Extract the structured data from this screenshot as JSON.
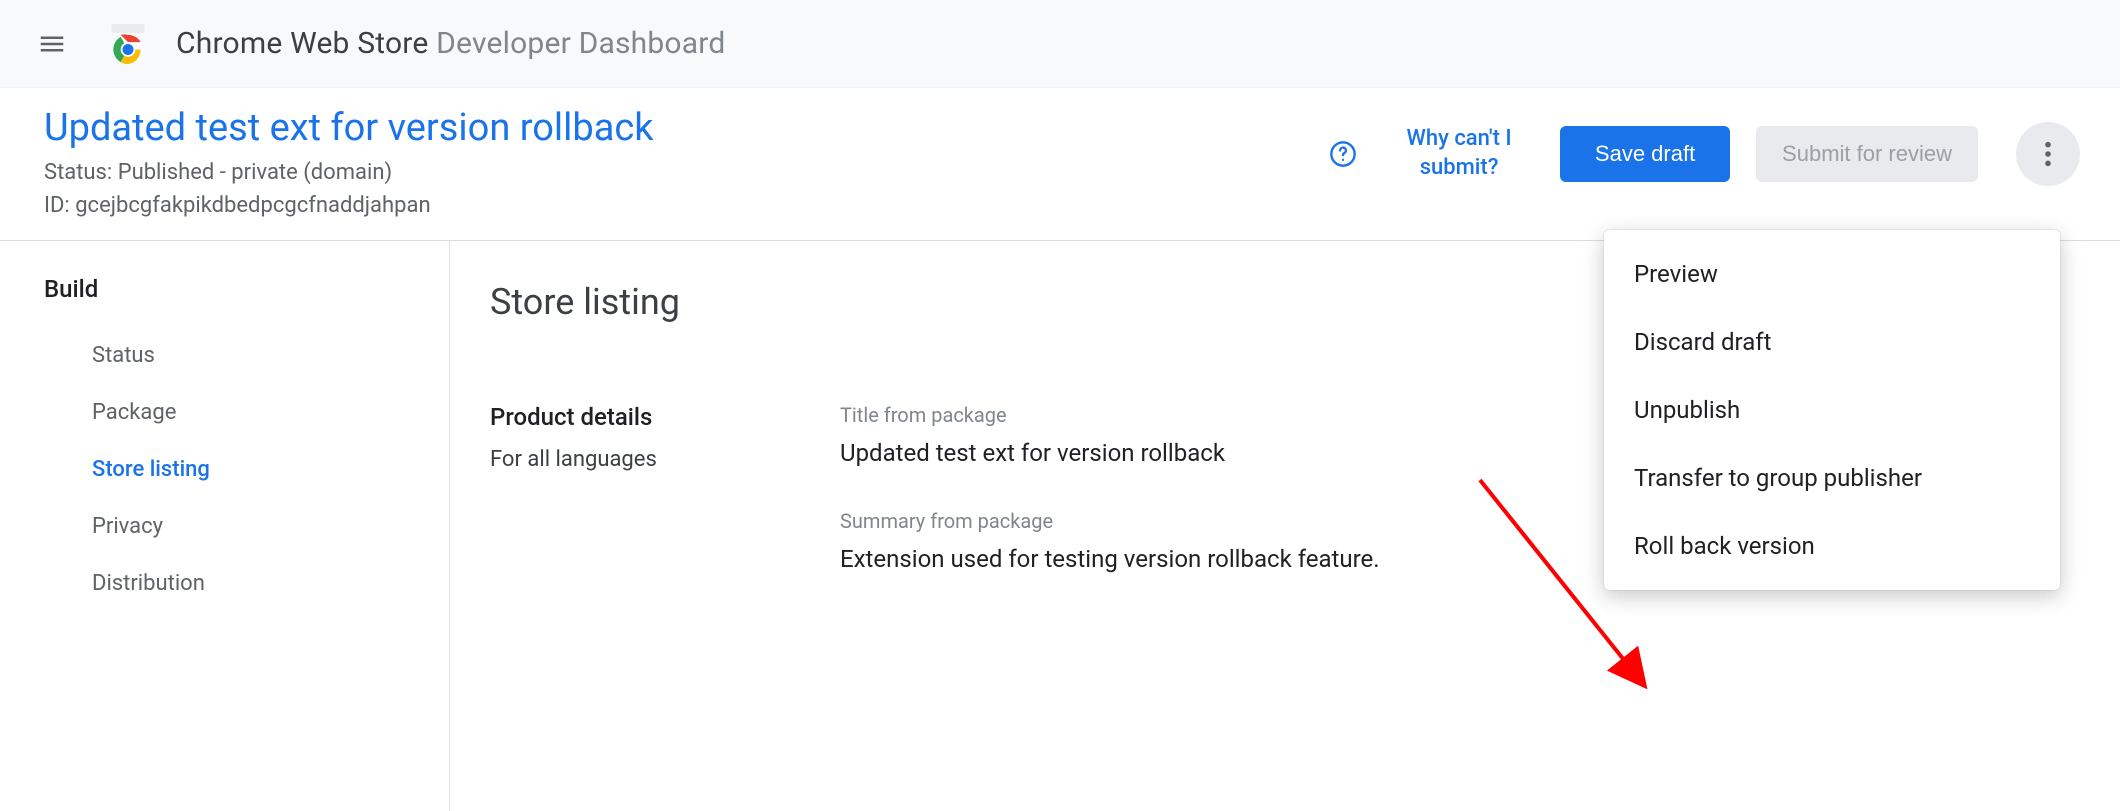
{
  "brand": {
    "name": "Chrome Web Store",
    "section": "Developer Dashboard"
  },
  "extension": {
    "title": "Updated test ext for version rollback",
    "status_label": "Status: Published - private (domain)",
    "id_label": "ID: gcejbcgfakpikdbedpcgcfnaddjahpan"
  },
  "header_actions": {
    "why_cant_submit": "Why can't I submit?",
    "save_draft": "Save draft",
    "submit_for_review": "Submit for review"
  },
  "sidebar": {
    "heading": "Build",
    "items": [
      {
        "label": "Status",
        "active": false
      },
      {
        "label": "Package",
        "active": false
      },
      {
        "label": "Store listing",
        "active": true
      },
      {
        "label": "Privacy",
        "active": false
      },
      {
        "label": "Distribution",
        "active": false
      }
    ]
  },
  "main": {
    "page_title": "Store listing",
    "product_details": {
      "heading": "Product details",
      "subheading": "For all languages",
      "title_label": "Title from package",
      "title_value": "Updated test ext for version rollback",
      "summary_label": "Summary from package",
      "summary_value": "Extension used for testing version rollback feature."
    }
  },
  "overflow_menu": {
    "items": [
      "Preview",
      "Discard draft",
      "Unpublish",
      "Transfer to group publisher",
      "Roll back version"
    ]
  },
  "colors": {
    "link": "#1a73e8",
    "muted": "#5f6368"
  }
}
